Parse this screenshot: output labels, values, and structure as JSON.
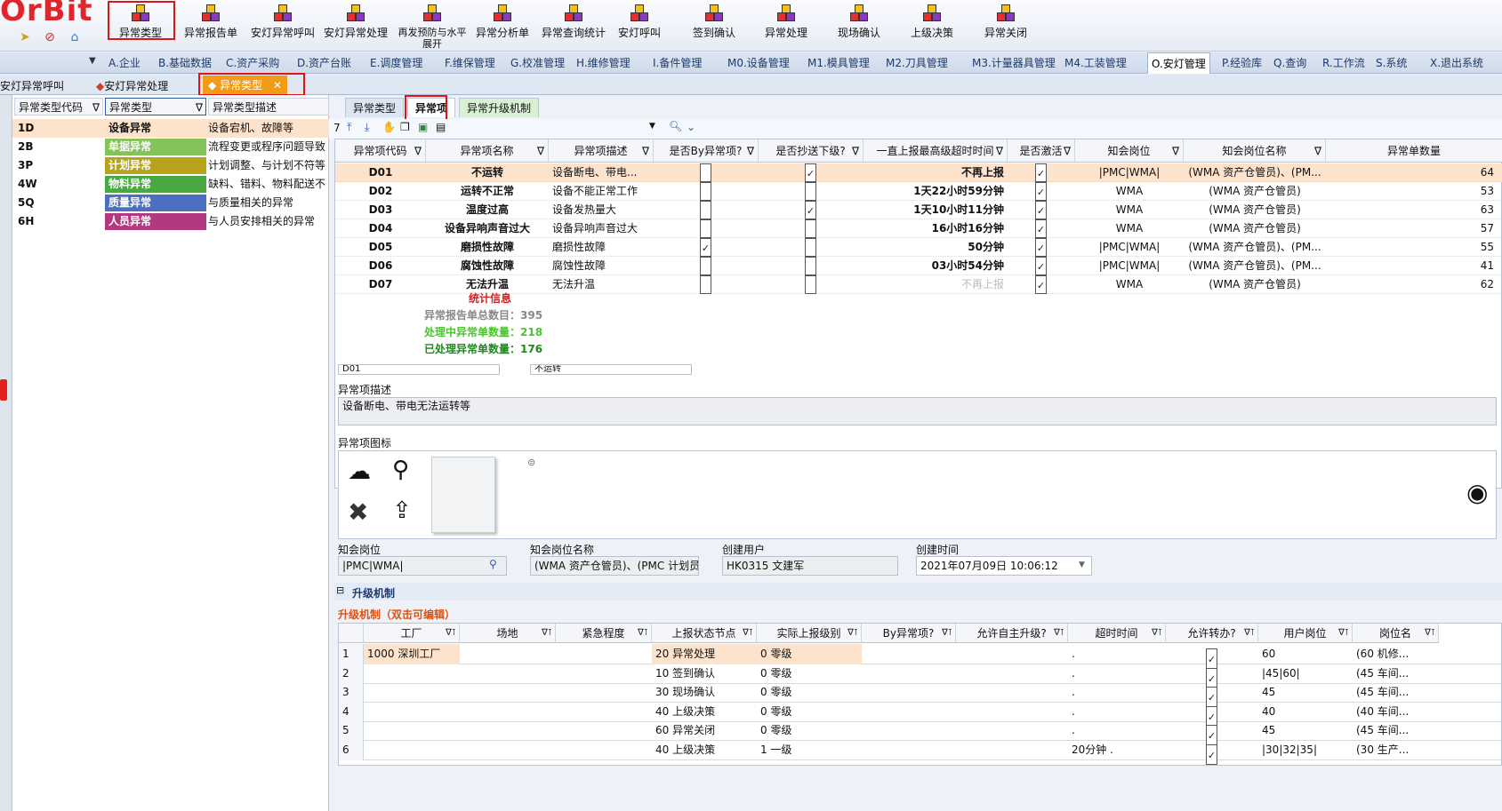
{
  "app": {
    "logo": "OrBit"
  },
  "ribbon": {
    "buttons": [
      {
        "label": "异常类型",
        "icon": "cubes-icon"
      },
      {
        "label": "异常报告单",
        "icon": "report-icon"
      },
      {
        "label": "安灯异常呼叫",
        "icon": "andon-call-icon"
      },
      {
        "label": "安灯异常处理",
        "icon": "andon-handle-icon"
      },
      {
        "label": "再发预防与水平展开",
        "icon": "prevent-icon"
      },
      {
        "label": "异常分析单",
        "icon": "analysis-icon"
      },
      {
        "label": "异常查询统计",
        "icon": "stats-icon"
      },
      {
        "label": "安灯呼叫",
        "icon": "cubes-icon"
      },
      {
        "label": "签到确认",
        "icon": "cubes-icon"
      },
      {
        "label": "异常处理",
        "icon": "cubes-icon"
      },
      {
        "label": "现场确认",
        "icon": "cubes-icon"
      },
      {
        "label": "上级决策",
        "icon": "cubes-icon"
      },
      {
        "label": "异常关闭",
        "icon": "cubes-icon"
      }
    ]
  },
  "modules": [
    "A.企业",
    "B.基础数据",
    "C.资产采购",
    "D.资产台账",
    "E.调度管理",
    "F.维保管理",
    "G.校准管理",
    "H.维修管理",
    "I.备件管理",
    "M0.设备管理",
    "M1.模具管理",
    "M2.刀具管理",
    "M3.计量器具管理",
    "M4.工装管理",
    "O.安灯管理",
    "P.经验库",
    "Q.查询",
    "R.工作流",
    "S.系统",
    "X.退出系统"
  ],
  "doc_tabs": [
    "安灯异常呼叫",
    "安灯异常处理",
    "异常类型"
  ],
  "left_grid": {
    "headers": [
      "异常类型代码",
      "异常类型",
      "异常类型描述"
    ],
    "rows": [
      {
        "code": "1D",
        "type": "设备异常",
        "desc": "设备宕机、故障等",
        "color": "#ffffff"
      },
      {
        "code": "2B",
        "type": "单据异常",
        "desc": "流程变更或程序问题导致",
        "color": "#84c25a"
      },
      {
        "code": "3P",
        "type": "计划异常",
        "desc": "计划调整、与计划不符等",
        "color": "#b8a41c"
      },
      {
        "code": "4W",
        "type": "物料异常",
        "desc": "缺料、错料、物料配送不",
        "color": "#4aa843"
      },
      {
        "code": "5Q",
        "type": "质量异常",
        "desc": "与质量相关的异常",
        "color": "#4d6fc1"
      },
      {
        "code": "6H",
        "type": "人员异常",
        "desc": "与人员安排相关的异常",
        "color": "#b2387f"
      }
    ]
  },
  "right_tabs": [
    "异常类型",
    "异常项",
    "异常升级机制"
  ],
  "toolbar": {
    "count": "7"
  },
  "main_grid": {
    "headers": [
      "异常项代码",
      "异常项名称",
      "异常项描述",
      "是否By异常项?",
      "是否抄送下级?",
      "一直上报最高级超时时间",
      "是否激活",
      "知会岗位",
      "知会岗位名称",
      "异常单数量"
    ],
    "rows": [
      {
        "code": "D01",
        "name": "不运转",
        "desc": "设备断电、带电...",
        "by": false,
        "cc": true,
        "timeout": "不再上报",
        "active": true,
        "post": "|PMC|WMA|",
        "postname": "(WMA 资产仓管员)、(PM...",
        "count": "64"
      },
      {
        "code": "D02",
        "name": "运转不正常",
        "desc": "设备不能正常工作",
        "by": false,
        "cc": false,
        "timeout": "1天22小时59分钟",
        "active": true,
        "post": "WMA",
        "postname": "(WMA 资产仓管员)",
        "count": "53"
      },
      {
        "code": "D03",
        "name": "温度过高",
        "desc": "设备发热量大",
        "by": false,
        "cc": true,
        "timeout": "1天10小时11分钟",
        "active": true,
        "post": "WMA",
        "postname": "(WMA 资产仓管员)",
        "count": "63"
      },
      {
        "code": "D04",
        "name": "设备异响声音过大",
        "desc": "设备异响声音过大",
        "by": false,
        "cc": false,
        "timeout": "16小时16分钟",
        "active": true,
        "post": "WMA",
        "postname": "(WMA 资产仓管员)",
        "count": "57"
      },
      {
        "code": "D05",
        "name": "磨损性故障",
        "desc": "磨损性故障",
        "by": true,
        "cc": false,
        "timeout": "50分钟",
        "active": true,
        "post": "|PMC|WMA|",
        "postname": "(WMA 资产仓管员)、(PM...",
        "count": "55"
      },
      {
        "code": "D06",
        "name": "腐蚀性故障",
        "desc": "腐蚀性故障",
        "by": false,
        "cc": false,
        "timeout": "03小时54分钟",
        "active": true,
        "post": "|PMC|WMA|",
        "postname": "(WMA 资产仓管员)、(PM...",
        "count": "41"
      },
      {
        "code": "D07",
        "name": "无法升温",
        "desc": "无法升温",
        "by": false,
        "cc": false,
        "timeout": "不再上报",
        "active": true,
        "post": "WMA",
        "postname": "(WMA 资产仓管员)",
        "count": "62"
      }
    ],
    "stats": {
      "title": "统计信息",
      "total": "异常报告单总数目：395",
      "processing": "处理中异常单数量：218",
      "done": "已处理异常单数量：176"
    }
  },
  "detail": {
    "code_value": "D01",
    "name_value": "不运转",
    "desc_label": "异常项描述",
    "desc_value": "设备断电、带电无法运转等",
    "icon_label": "异常项图标",
    "post_label": "知会岗位",
    "post_value": "|PMC|WMA|",
    "postname_label": "知会岗位名称",
    "postname_value": "(WMA 资产仓管员)、(PMC 计划员",
    "creator_label": "创建用户",
    "creator_value": "HK0315 文建军",
    "created_label": "创建时间",
    "created_value": "2021年07月09日 10:06:12"
  },
  "escalation": {
    "section_title": "升级机制",
    "sub_title": "升级机制（双击可编辑）",
    "headers": [
      "工厂",
      "场地",
      "紧急程度",
      "上报状态节点",
      "实际上报级别",
      "By异常项?",
      "允许自主升级?",
      "超时时间",
      "允许转办?",
      "用户岗位",
      "岗位名"
    ],
    "rows": [
      {
        "n": "1",
        "factory": "1000 深圳工厂",
        "node": "20 异常处理",
        "level": "0 零级",
        "timeout": ".",
        "post": "60",
        "postname": "(60 机修..."
      },
      {
        "n": "2",
        "factory": "",
        "node": "10 签到确认",
        "level": "0 零级",
        "timeout": ".",
        "post": "|45|60|",
        "postname": "(45 车间..."
      },
      {
        "n": "3",
        "factory": "",
        "node": "30 现场确认",
        "level": "0 零级",
        "timeout": ".",
        "post": "45",
        "postname": "(45 车间..."
      },
      {
        "n": "4",
        "factory": "",
        "node": "40 上级决策",
        "level": "0 零级",
        "timeout": ".",
        "post": "40",
        "postname": "(40 车间..."
      },
      {
        "n": "5",
        "factory": "",
        "node": "60 异常关闭",
        "level": "0 零级",
        "timeout": ".",
        "post": "45",
        "postname": "(45 车间..."
      },
      {
        "n": "6",
        "factory": "",
        "node": "40 上级决策",
        "level": "1 一级",
        "timeout": "20分钟 .",
        "post": "|30|32|35|",
        "postname": "(30 生产..."
      }
    ]
  },
  "colors": {
    "highlight_row": "#fde3cc",
    "selection_red": "#e01414",
    "active_tab": "#f29b16",
    "stat_red": "#d42020",
    "stat_gray": "#888888",
    "stat_green": "#4dc233",
    "stat_dark_green": "#1c8a1c"
  }
}
